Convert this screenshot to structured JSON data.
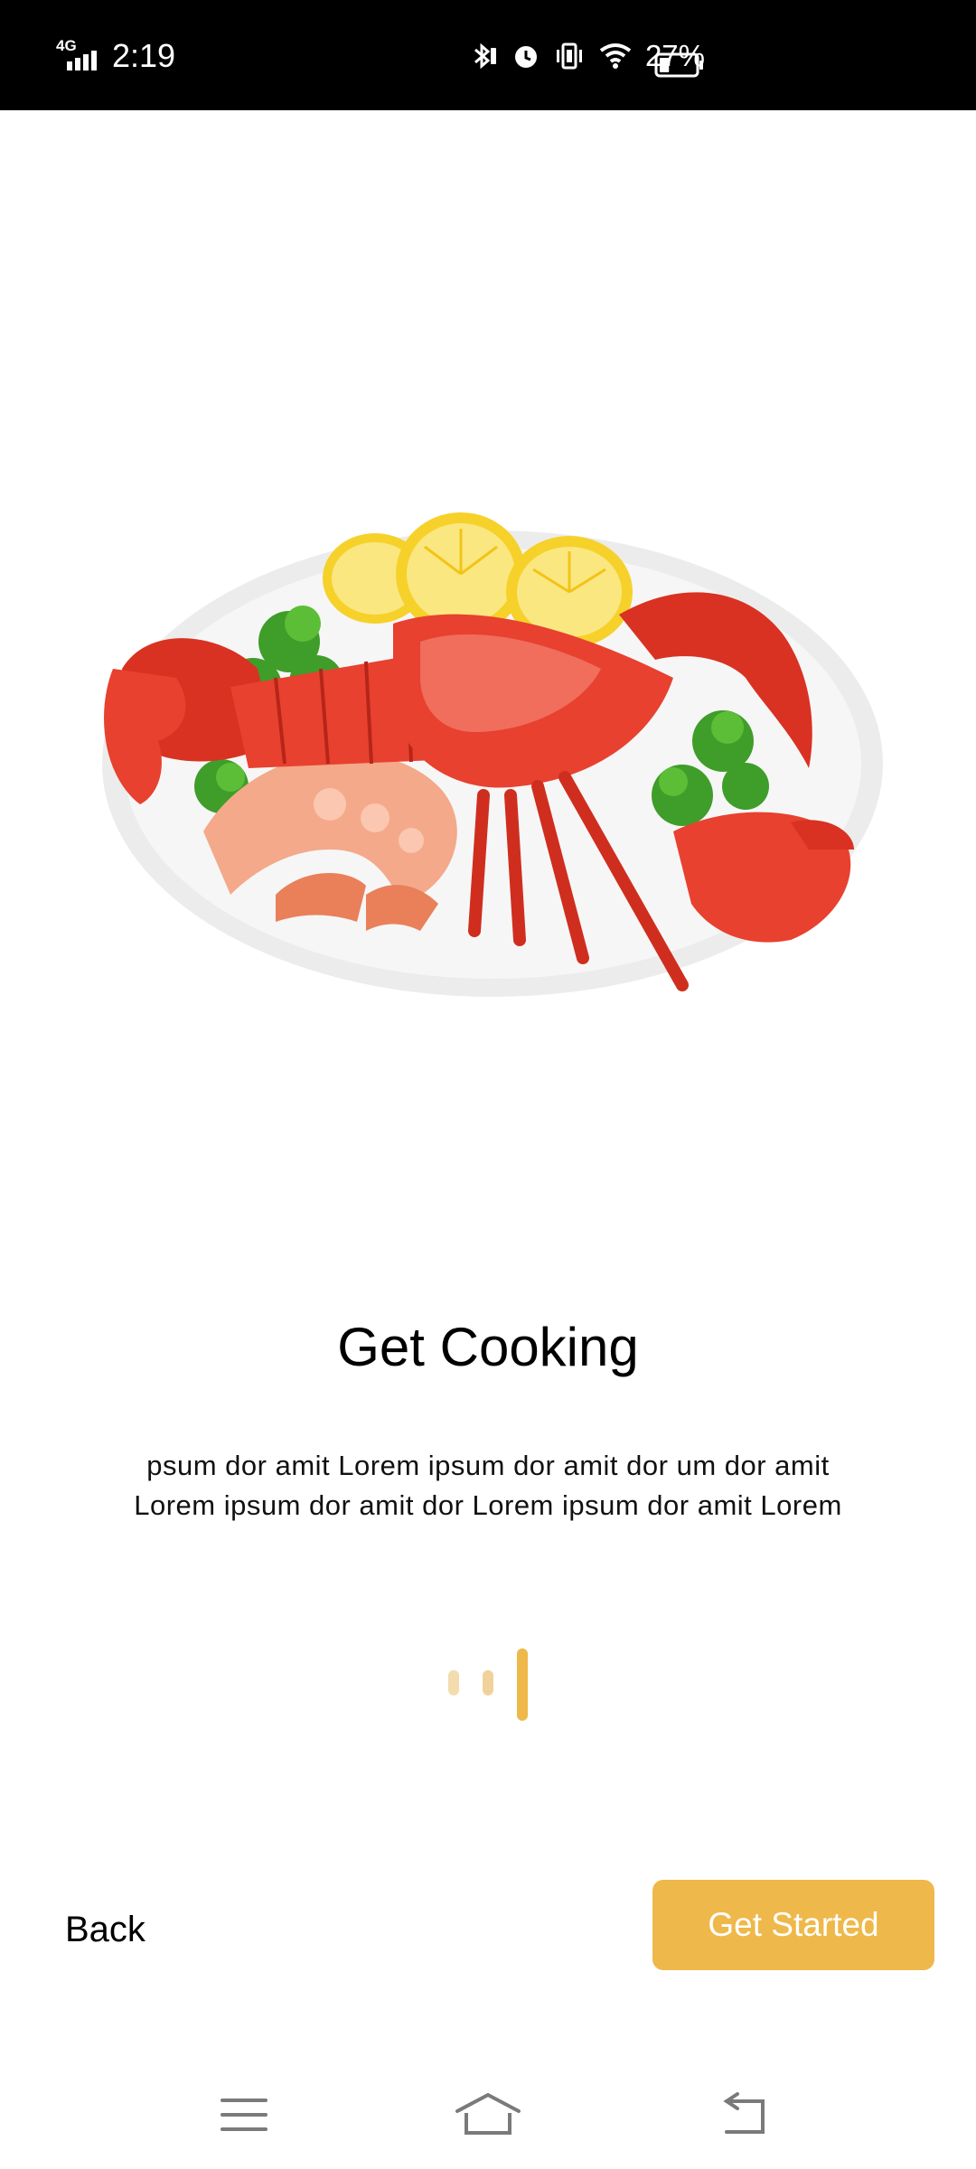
{
  "status_bar": {
    "network": "4G",
    "time": "2:19",
    "battery_percent": "27%",
    "battery_level": 0.27,
    "icons": [
      "signal-icon",
      "bluetooth-icon",
      "alarm-icon",
      "vibrate-icon",
      "wifi-icon",
      "battery-icon"
    ]
  },
  "onboarding": {
    "title": "Get Cooking",
    "description_lines": [
      "psum dor amit Lorem ipsum dor amit dor um dor amit",
      "Lorem ipsum dor amit dor Lorem ipsum dor amit Lorem"
    ],
    "page_indicator": {
      "count": 3,
      "active_index": 2
    },
    "back_label": "Back",
    "get_started_label": "Get Started"
  },
  "colors": {
    "accent": "#efb84a",
    "status_bar_bg": "#000000",
    "background": "#ffffff"
  },
  "navigation_bar": {
    "icons": [
      "menu-icon",
      "home-icon",
      "back-icon"
    ]
  }
}
